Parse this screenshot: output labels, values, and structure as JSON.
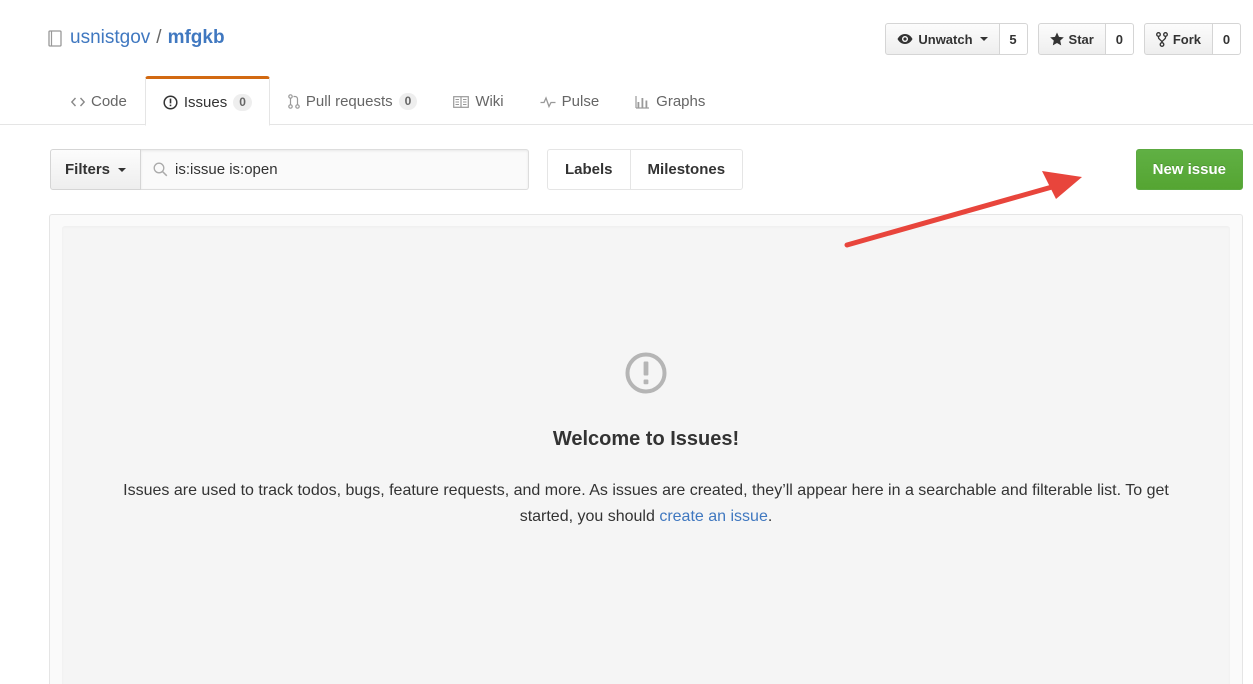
{
  "repo": {
    "owner": "usnistgov",
    "separator": "/",
    "name": "mfgkb"
  },
  "actions": {
    "watch_label": "Unwatch",
    "watch_count": "5",
    "star_label": "Star",
    "star_count": "0",
    "fork_label": "Fork",
    "fork_count": "0"
  },
  "tabs": [
    {
      "label": "Code",
      "icon": "code-icon"
    },
    {
      "label": "Issues",
      "icon": "issue-opened-icon",
      "count": "0",
      "selected": true
    },
    {
      "label": "Pull requests",
      "icon": "git-pull-request-icon",
      "count": "0"
    },
    {
      "label": "Wiki",
      "icon": "book-icon"
    },
    {
      "label": "Pulse",
      "icon": "pulse-icon"
    },
    {
      "label": "Graphs",
      "icon": "graph-icon"
    }
  ],
  "subnav": {
    "filters_label": "Filters",
    "search_value": "is:issue is:open",
    "labels_label": "Labels",
    "milestones_label": "Milestones",
    "new_issue_label": "New issue"
  },
  "blankslate": {
    "title": "Welcome to Issues!",
    "text_before": "Issues are used to track todos, bugs, feature requests, and more. As issues are created, they’ll appear here in a searchable and filterable list. To get started, you should ",
    "link_text": "create an issue",
    "text_after": "."
  },
  "colors": {
    "link": "#4078c0",
    "selected_tab_accent": "#d26911",
    "primary_button": "#55a532",
    "annotation_arrow": "#e8453c"
  }
}
